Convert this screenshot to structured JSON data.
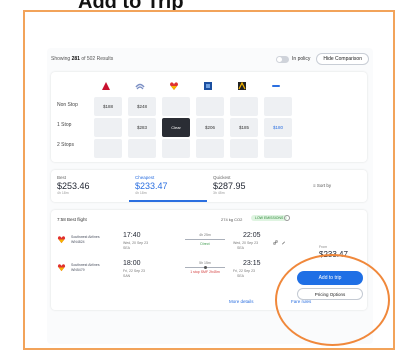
{
  "heading": "Add to Trip",
  "topbar": {
    "showing_prefix": "Showing",
    "showing_count": "281",
    "showing_suffix": "of 502 Results",
    "policy_label": "In policy",
    "hide_comparison": "Hide Comparison"
  },
  "matrix": {
    "airlines": [
      {
        "icon": "delta-logo-icon",
        "color": "#c8102e"
      },
      {
        "icon": "united-logo-icon",
        "color": "#7b8fc4"
      },
      {
        "icon": "southwest-logo-icon",
        "color": "#e0312f"
      },
      {
        "icon": "alaska-logo-icon",
        "color": "#1b4fa0"
      },
      {
        "icon": "multi-airline-logo-icon",
        "color": "#222222"
      },
      {
        "icon": "spirit-logo-icon",
        "color": "#2b6fe0"
      }
    ],
    "rows": [
      {
        "label": "Non Stop",
        "cells": [
          "$188",
          "$248",
          "",
          "",
          "",
          ""
        ]
      },
      {
        "label": "1 Stop",
        "cells": [
          "",
          "$283",
          "Clear",
          "$206",
          "$185",
          "$180"
        ]
      },
      {
        "label": "2 Stops",
        "cells": [
          "",
          "",
          "",
          "",
          "",
          ""
        ]
      }
    ]
  },
  "tabs": [
    {
      "label": "Best",
      "price": "$253.46",
      "sub": "4h 18m"
    },
    {
      "label": "Cheapest",
      "price": "$233.47",
      "sub": "4h 18m"
    },
    {
      "label": "Quickest",
      "price": "$287.95",
      "sub": "3h 45m"
    }
  ],
  "sort_label": "Sort by",
  "card": {
    "best_label": "7:58 Best flight",
    "co2": "274 kg CO2",
    "co2_badge": "LOW EMISSIONS",
    "legs": [
      {
        "airline": "Southwest Airlines",
        "flight": "WN4824",
        "depart_time": "17:40",
        "depart_date": "Wed, 20 Sep 23",
        "depart_code": "SEA",
        "duration": "4h 25m",
        "stops": "Direct",
        "arrive_time": "22:05",
        "arrive_date": "Wed, 20 Sep 23",
        "arrive_code": "SEA"
      },
      {
        "airline": "Southwest Airlines",
        "flight": "WN5479",
        "depart_time": "18:00",
        "depart_date": "Fri, 22 Sep 23",
        "depart_code": "SAN",
        "duration": "5h 15m",
        "stops": "1 stop SMF 2h45m",
        "arrive_time": "23:15",
        "arrive_date": "Fri, 22 Sep 23",
        "arrive_code": "SEA"
      }
    ],
    "from_label": "From",
    "price": "$233.47",
    "more_details": "More details",
    "fare_rules": "Fare rules"
  },
  "actions": {
    "add_to_trip": "Add to trip",
    "pricing_options": "Pricing Options"
  },
  "colors": {
    "accent": "#1f6fe5",
    "highlight": "#f0883b"
  }
}
